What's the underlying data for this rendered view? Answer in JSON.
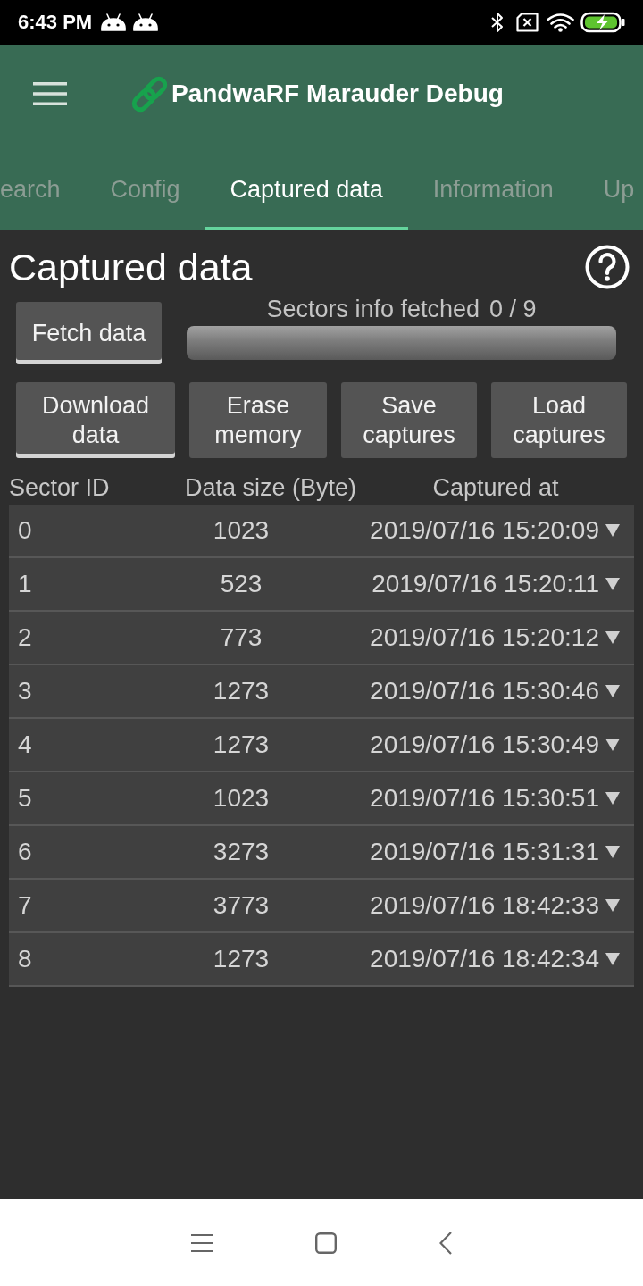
{
  "status_bar": {
    "time": "6:43 PM"
  },
  "app_bar": {
    "title": "PandwaRF Marauder Debug"
  },
  "tabs": [
    {
      "label": "earch",
      "selected": false
    },
    {
      "label": "Config",
      "selected": false
    },
    {
      "label": "Captured data",
      "selected": true
    },
    {
      "label": "Information",
      "selected": false
    },
    {
      "label": "Up",
      "selected": false
    }
  ],
  "page": {
    "title": "Captured data"
  },
  "fetch_button": {
    "label": "Fetch data",
    "highlighted": true
  },
  "progress": {
    "label": "Sectors info fetched",
    "count": "0 / 9",
    "level": 0
  },
  "actions": [
    {
      "label": "Download data",
      "highlighted": true
    },
    {
      "label": "Erase memory",
      "highlighted": false
    },
    {
      "label": "Save captures",
      "highlighted": false
    },
    {
      "label": "Load captures",
      "highlighted": false
    }
  ],
  "table": {
    "columns": [
      "Sector ID",
      "Data size (Byte)",
      "Captured at"
    ],
    "rows": [
      {
        "sector_id": "0",
        "data_size": "1023",
        "captured_at": "2019/07/16 15:20:09"
      },
      {
        "sector_id": "1",
        "data_size": "523",
        "captured_at": "2019/07/16 15:20:11"
      },
      {
        "sector_id": "2",
        "data_size": "773",
        "captured_at": "2019/07/16 15:20:12"
      },
      {
        "sector_id": "3",
        "data_size": "1273",
        "captured_at": "2019/07/16 15:30:46"
      },
      {
        "sector_id": "4",
        "data_size": "1273",
        "captured_at": "2019/07/16 15:30:49"
      },
      {
        "sector_id": "5",
        "data_size": "1023",
        "captured_at": "2019/07/16 15:30:51"
      },
      {
        "sector_id": "6",
        "data_size": "3273",
        "captured_at": "2019/07/16 15:31:31"
      },
      {
        "sector_id": "7",
        "data_size": "3773",
        "captured_at": "2019/07/16 18:42:33"
      },
      {
        "sector_id": "8",
        "data_size": "1273",
        "captured_at": "2019/07/16 18:42:34"
      }
    ]
  }
}
